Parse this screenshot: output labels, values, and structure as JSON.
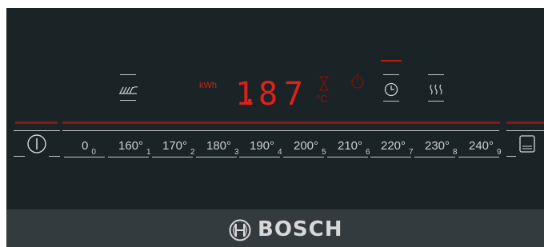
{
  "display": {
    "unit_label": "kWh",
    "value": "1.87",
    "digit_1": "1",
    "digit_2": "8",
    "digit_3": "7",
    "decimal": "."
  },
  "temperature_scale": [
    {
      "label": "0",
      "index": "0"
    },
    {
      "label": "160°",
      "index": "1"
    },
    {
      "label": "170°",
      "index": "2"
    },
    {
      "label": "180°",
      "index": "3"
    },
    {
      "label": "190°",
      "index": "4"
    },
    {
      "label": "200°",
      "index": "5"
    },
    {
      "label": "210°",
      "index": "6"
    },
    {
      "label": "220°",
      "index": "7"
    },
    {
      "label": "230°",
      "index": "8"
    },
    {
      "label": "240°",
      "index": "9"
    }
  ],
  "brand": {
    "name": "BOSCH"
  },
  "colors": {
    "panel": "#1a2326",
    "bottom_bar": "#333b3e",
    "led_red": "#d0201c",
    "text_white": "#cfcfcf"
  },
  "icons": [
    "power-icon",
    "grill-icon",
    "hourglass-icon",
    "celsius-icon",
    "timer-icon",
    "clock-icon",
    "steam-icon",
    "menu-icon",
    "bosch-logo-icon"
  ]
}
